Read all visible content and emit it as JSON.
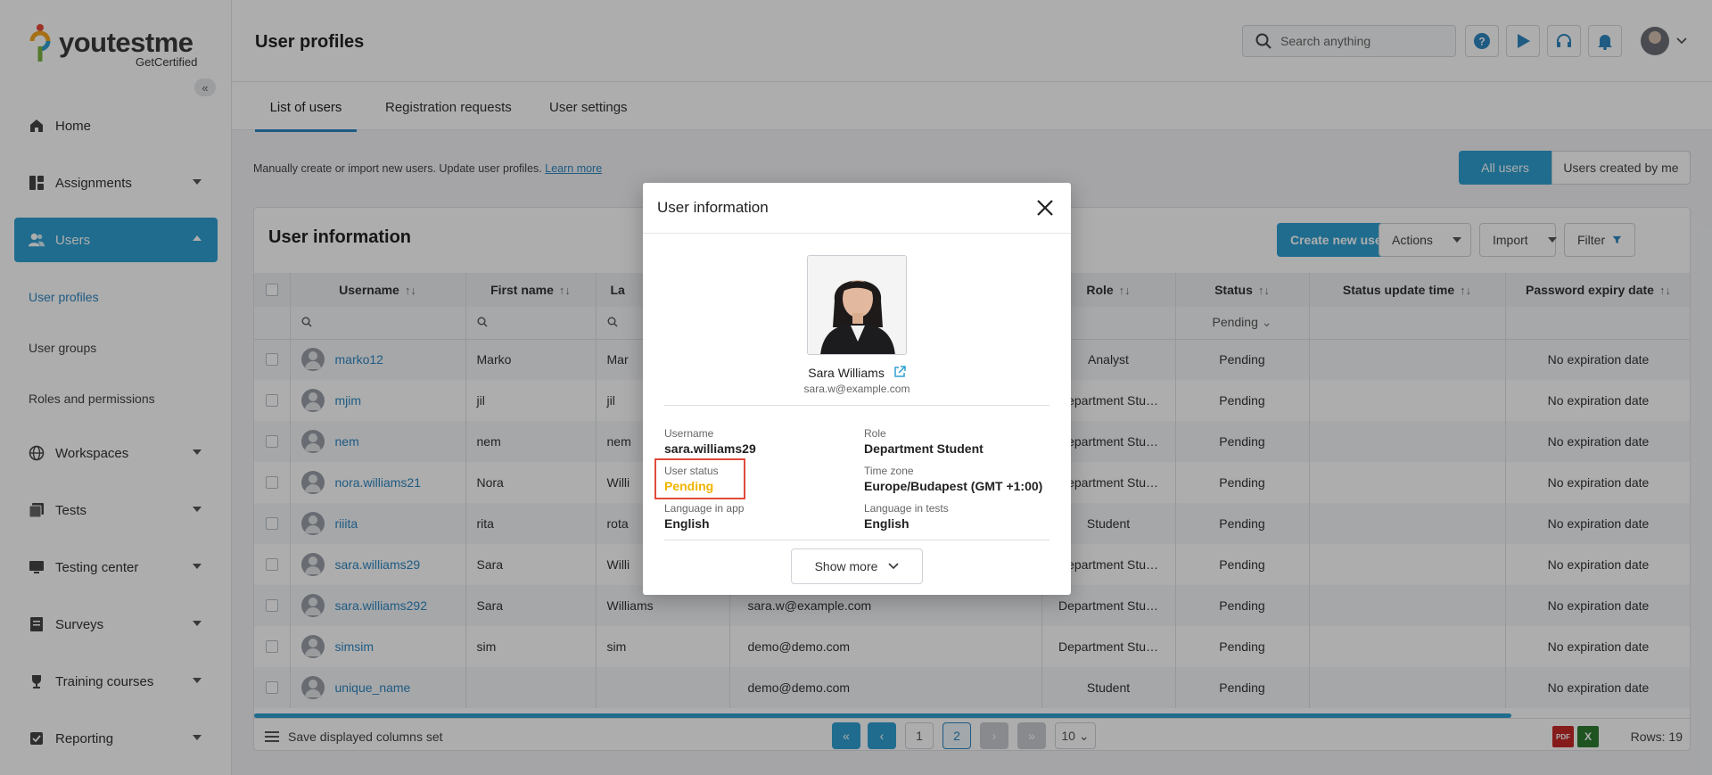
{
  "brand": {
    "name": "youtestme",
    "sub": "GetCertified"
  },
  "sidebar": {
    "items": [
      {
        "label": "Home",
        "icon": "home-icon"
      },
      {
        "label": "Assignments",
        "icon": "assignments-icon"
      },
      {
        "label": "Users",
        "icon": "users-icon"
      },
      {
        "label": "Workspaces",
        "icon": "globe-icon"
      },
      {
        "label": "Tests",
        "icon": "tests-icon"
      },
      {
        "label": "Testing center",
        "icon": "monitor-icon"
      },
      {
        "label": "Surveys",
        "icon": "surveys-icon"
      },
      {
        "label": "Training courses",
        "icon": "trophy-icon"
      },
      {
        "label": "Reporting",
        "icon": "reporting-icon"
      }
    ],
    "users_sub": [
      "User profiles",
      "User groups",
      "Roles and permissions"
    ]
  },
  "header": {
    "title": "User profiles",
    "search_placeholder": "Search anything"
  },
  "tabs": [
    "List of users",
    "Registration requests",
    "User settings"
  ],
  "description": {
    "text": "Manually create or import new users. Update user profiles.",
    "link": "Learn more"
  },
  "scope": {
    "all": "All users",
    "mine": "Users created by me"
  },
  "card": {
    "title": "User information",
    "create_btn": "Create new user",
    "actions_btn": "Actions",
    "import_btn": "Import",
    "filter_btn": "Filter"
  },
  "table": {
    "headers": {
      "username": "Username",
      "first_name": "First name",
      "last_name": "La",
      "role": "Role",
      "status": "Status",
      "status_update": "Status update time",
      "password_expiry": "Password expiry date"
    },
    "status_filter": "Pending",
    "rows": [
      {
        "username": "marko12",
        "first": "Marko",
        "last": "Mar",
        "email": "",
        "role": "Analyst",
        "status": "Pending",
        "expiry": "No expiration date"
      },
      {
        "username": "mjim",
        "first": "jil",
        "last": "jil",
        "email": "",
        "role": "Department Stu…",
        "status": "Pending",
        "expiry": "No expiration date"
      },
      {
        "username": "nem",
        "first": "nem",
        "last": "nem",
        "email": "",
        "role": "Department Stu…",
        "status": "Pending",
        "expiry": "No expiration date"
      },
      {
        "username": "nora.williams21",
        "first": "Nora",
        "last": "Willi",
        "email": "",
        "role": "Department Stu…",
        "status": "Pending",
        "expiry": "No expiration date"
      },
      {
        "username": "riiita",
        "first": "rita",
        "last": "rota",
        "email": "",
        "role": "Student",
        "status": "Pending",
        "expiry": "No expiration date"
      },
      {
        "username": "sara.williams29",
        "first": "Sara",
        "last": "Willi",
        "email": "",
        "role": "Department Stu…",
        "status": "Pending",
        "expiry": "No expiration date"
      },
      {
        "username": "sara.williams292",
        "first": "Sara",
        "last": "Williams",
        "email": "sara.w@example.com",
        "role": "Department Stu…",
        "status": "Pending",
        "expiry": "No expiration date"
      },
      {
        "username": "simsim",
        "first": "sim",
        "last": "sim",
        "email": "demo@demo.com",
        "role": "Department Stu…",
        "status": "Pending",
        "expiry": "No expiration date"
      },
      {
        "username": "unique_name",
        "first": "",
        "last": "",
        "email": "demo@demo.com",
        "role": "Student",
        "status": "Pending",
        "expiry": "No expiration date"
      }
    ]
  },
  "footer": {
    "save_set": "Save displayed columns set",
    "pages": [
      "1",
      "2"
    ],
    "page_size": "10",
    "rows_label": "Rows: 19",
    "pdf_label": "PDF",
    "xls_label": "X"
  },
  "modal": {
    "title": "User information",
    "name": "Sara Williams",
    "email": "sara.w@example.com",
    "fields": {
      "username_label": "Username",
      "username": "sara.williams29",
      "role_label": "Role",
      "role": "Department Student",
      "status_label": "User status",
      "status": "Pending",
      "tz_label": "Time zone",
      "tz": "Europe/Budapest (GMT +1:00)",
      "lang_app_label": "Language in app",
      "lang_app": "English",
      "lang_tests_label": "Language in tests",
      "lang_tests": "English"
    },
    "show_more": "Show more"
  },
  "colors": {
    "accent": "#2e9fd2",
    "pending": "#f2b400",
    "highlight": "#e04b3c"
  }
}
